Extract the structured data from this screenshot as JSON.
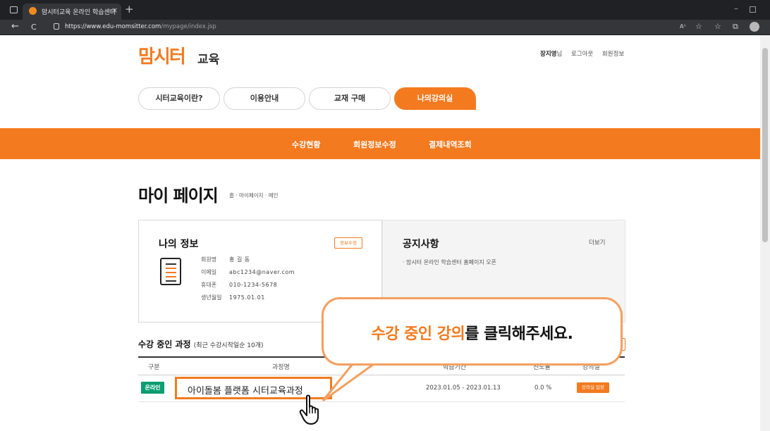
{
  "browser": {
    "tab_title": "맘시터교육 온라인 학습센터",
    "tab_close": "×",
    "new_tab": "+",
    "window_minimize": "–",
    "nav_back": "←",
    "nav_reload": "C",
    "url_domain": "https://www.edu-momsitter.com",
    "url_path": "/mypage/index.jsp"
  },
  "header": {
    "logo_main": "맘시터",
    "logo_sub": "교육",
    "user_name": "장지영",
    "user_suffix": "님",
    "logout": "로그아웃",
    "member_info": "회원정보"
  },
  "menu": {
    "items": [
      "시터교육이란?",
      "이용안내",
      "교재 구매",
      "나의강의실"
    ],
    "active_index": 3
  },
  "subnav": {
    "items": [
      "수강현황",
      "회원정보수정",
      "결제내역조회"
    ]
  },
  "page": {
    "title": "마이 페이지",
    "breadcrumb": "홈 · 마이페이지 · 메인"
  },
  "my_info": {
    "title": "나의 정보",
    "edit_button": "정보수정",
    "rows": [
      {
        "label": "회원명",
        "value": "홍 길 동"
      },
      {
        "label": "이메일",
        "value": "abc1234@naver.com"
      },
      {
        "label": "휴대폰",
        "value": "010-1234-5678"
      },
      {
        "label": "생년월일",
        "value": "1975.01.01"
      }
    ]
  },
  "notice": {
    "title": "공지사항",
    "more": "더보기",
    "items": [
      "· 맘시터 온라인 학습센터 홈페이지 오픈"
    ]
  },
  "courses": {
    "title": "수강 중인 과정",
    "subtitle": "(최근 수강시작일순 10개)",
    "headers": [
      "구분",
      "과정명",
      "학습기간",
      "진도율",
      "강의실"
    ],
    "rows": [
      {
        "type": "온라인",
        "name": "아이돌봄 플랫폼 시터교육과정",
        "period": "2023.01.05 - 2023.01.13",
        "progress": "0.0 %",
        "action": "강의실 입장"
      }
    ]
  },
  "callout": {
    "highlight": "수강 중인 강의",
    "rest": "를 클릭해주세요."
  },
  "colors": {
    "brand_orange": "#f47a1f",
    "badge_green": "#0a9e70"
  },
  "icons": {
    "doc": "document-icon",
    "hand": "hand-pointer-icon"
  }
}
